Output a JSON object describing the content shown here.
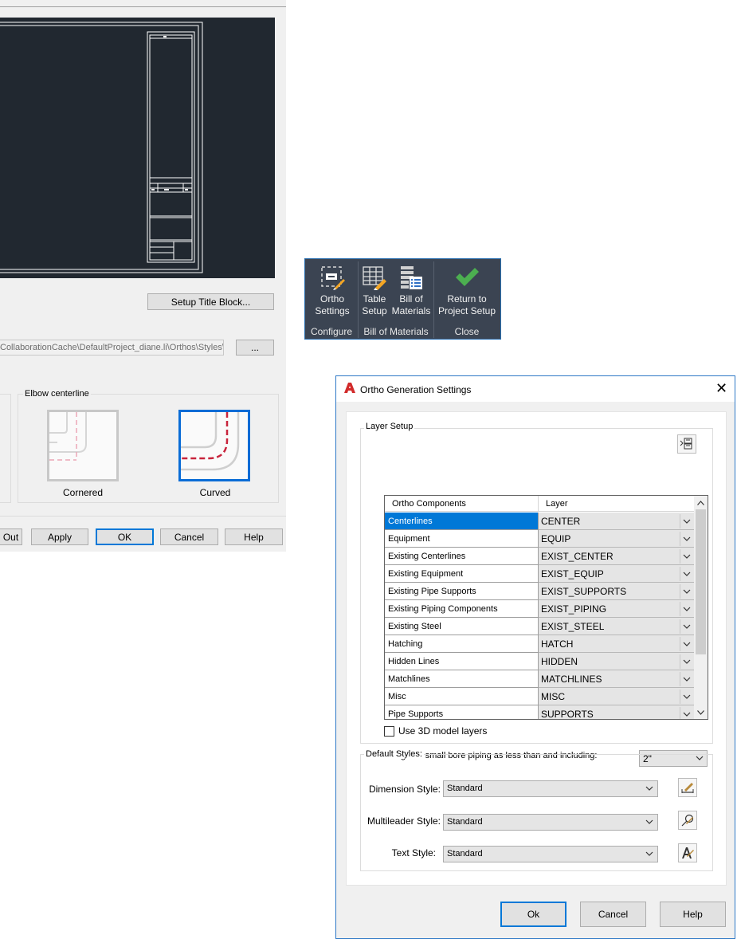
{
  "left_dialog": {
    "setup_title_block_label": "Setup Title Block...",
    "path_text": "CollaborationCache\\DefaultProject_diane.li\\Orthos\\Styles\\D",
    "browse_label": "...",
    "elbow_group_title": "Elbow centerline",
    "elbow_options": [
      {
        "label": "Cornered",
        "selected": false
      },
      {
        "label": "Curved",
        "selected": true
      }
    ],
    "buttons": {
      "out": "Out",
      "apply": "Apply",
      "ok": "OK",
      "cancel": "Cancel",
      "help": "Help"
    }
  },
  "ribbon": {
    "buttons": [
      {
        "line1": "Ortho",
        "line2": "Settings",
        "icon": "ortho-settings-icon"
      },
      {
        "line1": "Table",
        "line2": "Setup",
        "icon": "table-setup-icon"
      },
      {
        "line1": "Bill of",
        "line2": "Materials",
        "icon": "bill-of-materials-icon"
      },
      {
        "line1": "Return to",
        "line2": "Project Setup",
        "icon": "check-icon"
      }
    ],
    "groups": [
      "Configure",
      "Bill of Materials",
      "Close"
    ],
    "accent_color": "#4caf50"
  },
  "ortho_dialog": {
    "title": "Ortho Generation Settings",
    "layer_setup_title": "Layer Setup",
    "grid_headers": {
      "component": "Ortho Components",
      "layer": "Layer"
    },
    "rows": [
      {
        "component": "Centerlines",
        "layer": "CENTER"
      },
      {
        "component": "Equipment",
        "layer": "EQUIP"
      },
      {
        "component": "Existing Centerlines",
        "layer": "EXIST_CENTER"
      },
      {
        "component": "Existing Equipment",
        "layer": "EXIST_EQUIP"
      },
      {
        "component": "Existing Pipe Supports",
        "layer": "EXIST_SUPPORTS"
      },
      {
        "component": "Existing Piping Components",
        "layer": "EXIST_PIPING"
      },
      {
        "component": "Existing Steel",
        "layer": "EXIST_STEEL"
      },
      {
        "component": "Hatching",
        "layer": "HATCH"
      },
      {
        "component": "Hidden Lines",
        "layer": "HIDDEN"
      },
      {
        "component": "Matchlines",
        "layer": "MATCHLINES"
      },
      {
        "component": "Misc",
        "layer": "MISC"
      },
      {
        "component": "Pipe Supports",
        "layer": "SUPPORTS"
      }
    ],
    "selected_row": 0,
    "use_3d_label": "Use 3D model layers",
    "use_3d_checked": false,
    "small_bore_label": "Designate small bore piping as less than and including:",
    "small_bore_value": "2\"",
    "default_styles_title": "Default Styles:",
    "styles": [
      {
        "label": "Dimension Style:",
        "value": "Standard",
        "tool_icon": "dimension-style-icon"
      },
      {
        "label": "Multileader Style:",
        "value": "Standard",
        "tool_icon": "multileader-style-icon"
      },
      {
        "label": "Text Style:",
        "value": "Standard",
        "tool_icon": "text-style-icon"
      }
    ],
    "buttons": {
      "ok": "Ok",
      "cancel": "Cancel",
      "help": "Help"
    },
    "selection_color": "#0078d7"
  }
}
